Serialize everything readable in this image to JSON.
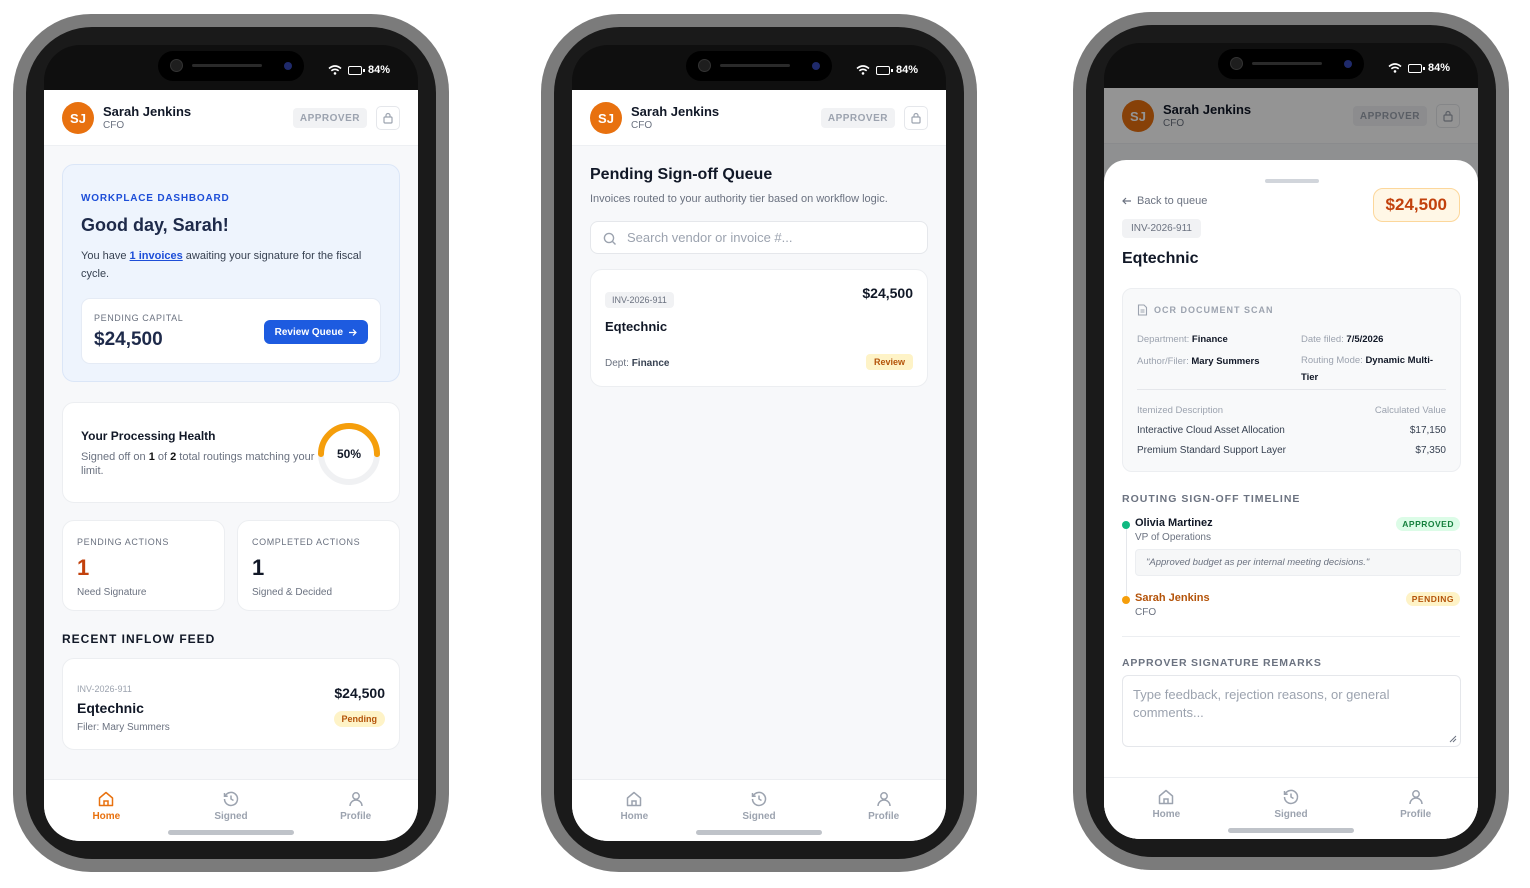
{
  "status": {
    "battery": "84%"
  },
  "user": {
    "initials": "SJ",
    "name": "Sarah Jenkins",
    "role": "CFO",
    "badge": "APPROVER"
  },
  "tabs": {
    "home": "Home",
    "signed": "Signed",
    "profile": "Profile"
  },
  "dashboard": {
    "eyebrow": "WORKPLACE DASHBOARD",
    "greeting": "Good day, Sarah!",
    "msg_pre": "You have ",
    "msg_link": "1 invoices",
    "msg_post": " awaiting your signature for the fiscal cycle.",
    "pending_capital_label": "PENDING CAPITAL",
    "pending_capital_value": "$24,500",
    "review_button": "Review Queue",
    "health_title": "Your Processing Health",
    "health_pre": "Signed off on ",
    "health_signed": "1",
    "health_mid": " of ",
    "health_total": "2",
    "health_post": " total routings matching your limit.",
    "health_percent": "50%",
    "health_fraction": 0.5,
    "pending_actions_label": "PENDING ACTIONS",
    "pending_actions_value": "1",
    "pending_actions_sub": "Need Signature",
    "completed_actions_label": "COMPLETED ACTIONS",
    "completed_actions_value": "1",
    "completed_actions_sub": "Signed & Decided",
    "feed_title": "RECENT INFLOW FEED",
    "feed_item": {
      "id": "INV-2026-911",
      "vendor": "Eqtechnic",
      "filer": "Filer: Mary Summers",
      "amount": "$24,500",
      "status": "Pending"
    }
  },
  "queue": {
    "title": "Pending Sign-off Queue",
    "subtitle": "Invoices routed to your authority tier based on workflow logic.",
    "search_placeholder": "Search vendor or invoice #...",
    "item": {
      "id": "INV-2026-911",
      "vendor": "Eqtechnic",
      "amount": "$24,500",
      "dept_label": "Dept: ",
      "dept": "Finance",
      "status": "Review"
    }
  },
  "detail": {
    "back": "Back to queue",
    "amount": "$24,500",
    "id": "INV-2026-911",
    "vendor": "Eqtechnic",
    "ocr_title": "OCR DOCUMENT SCAN",
    "department_label": "Department: ",
    "department": "Finance",
    "date_label": "Date filed: ",
    "date": "7/5/2026",
    "author_label": "Author/Filer: ",
    "author": "Mary Summers",
    "routing_label": "Routing Mode: ",
    "routing": "Dynamic Multi-Tier",
    "col_desc": "Itemized Description",
    "col_value": "Calculated Value",
    "lines": [
      {
        "desc": "Interactive Cloud Asset Allocation",
        "value": "$17,150"
      },
      {
        "desc": "Premium Standard Support Layer",
        "value": "$7,350"
      }
    ],
    "timeline_title": "ROUTING SIGN-OFF TIMELINE",
    "timeline": [
      {
        "name": "Olivia Martinez",
        "role": "VP of Operations",
        "status": "APPROVED",
        "note": "\"Approved budget as per internal meeting decisions.\""
      },
      {
        "name": "Sarah Jenkins",
        "role": "CFO",
        "status": "PENDING"
      }
    ],
    "remarks_title": "APPROVER SIGNATURE REMARKS",
    "remarks_placeholder": "Type feedback, rejection reasons, or general comments..."
  },
  "colors": {
    "accent": "#e8710f",
    "primary": "#1d4ed8",
    "approved": "#16a34a",
    "pending": "#d97706"
  }
}
